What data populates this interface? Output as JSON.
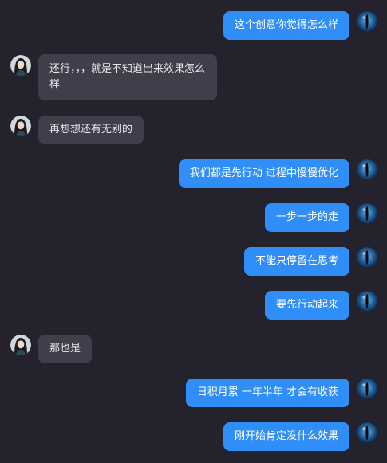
{
  "colors": {
    "background": "#24222d",
    "my_bubble": "#2f8ef8",
    "their_bubble": "#3f3e4a"
  },
  "messages": [
    {
      "side": "me",
      "text": "这个创意你觉得怎么样"
    },
    {
      "side": "other",
      "text": "还行，，，就是不知道出来效果怎么样"
    },
    {
      "side": "other",
      "text": "再想想还有无别的"
    },
    {
      "side": "me",
      "text": "我们都是先行动  过程中慢慢优化"
    },
    {
      "side": "me",
      "text": "一步一步的走"
    },
    {
      "side": "me",
      "text": "不能只停留在思考"
    },
    {
      "side": "me",
      "text": "要先行动起来"
    },
    {
      "side": "other",
      "text": "那也是"
    },
    {
      "side": "me",
      "text": "日积月累  一年半年  才会有收获"
    },
    {
      "side": "me",
      "text": "刚开始肯定没什么效果"
    }
  ],
  "icons": {
    "my_avatar": "blue-eye-avatar",
    "their_avatar": "woman-portrait-avatar"
  }
}
